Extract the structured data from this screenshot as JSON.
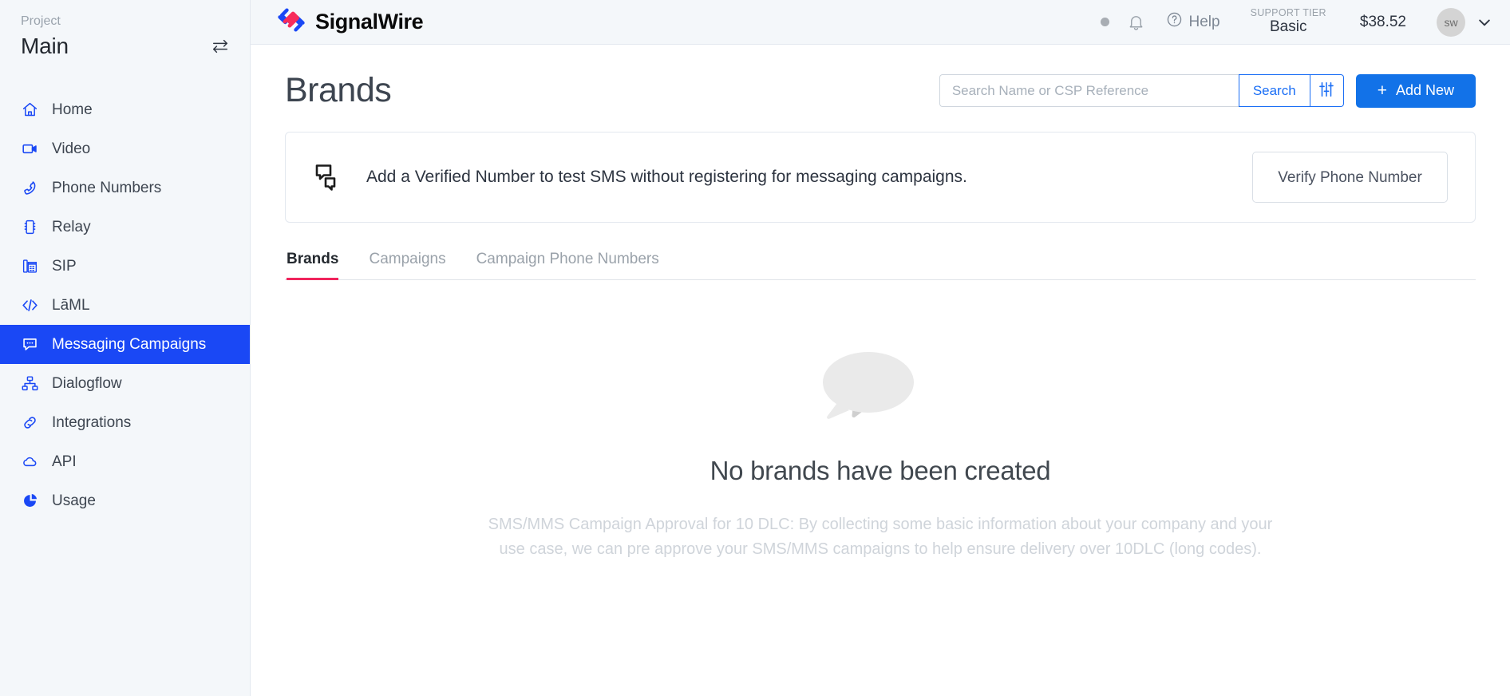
{
  "sidebar": {
    "project_label": "Project",
    "project_name": "Main",
    "swap_icon": "swap-arrows-icon",
    "items": [
      {
        "label": "Home",
        "icon": "home-icon",
        "active": false
      },
      {
        "label": "Video",
        "icon": "video-camera-icon",
        "active": false
      },
      {
        "label": "Phone Numbers",
        "icon": "phone-icon",
        "active": false
      },
      {
        "label": "Relay",
        "icon": "chip-icon",
        "active": false
      },
      {
        "label": "SIP",
        "icon": "desk-phone-icon",
        "active": false
      },
      {
        "label": "LāML",
        "icon": "code-brackets-icon",
        "active": false
      },
      {
        "label": "Messaging Campaigns",
        "icon": "chat-bubble-icon",
        "active": true
      },
      {
        "label": "Dialogflow",
        "icon": "sitemap-icon",
        "active": false
      },
      {
        "label": "Integrations",
        "icon": "link-icon",
        "active": false
      },
      {
        "label": "API",
        "icon": "cloud-icon",
        "active": false
      },
      {
        "label": "Usage",
        "icon": "pie-chart-icon",
        "active": false
      }
    ]
  },
  "topbar": {
    "brand_name": "SignalWire",
    "status_dot": "status-dot",
    "notifications_icon": "bell-icon",
    "help_icon": "question-circle-icon",
    "help_label": "Help",
    "support_tier_label": "SUPPORT TIER",
    "support_tier_value": "Basic",
    "balance": "$38.52",
    "avatar_initials": "sw",
    "caret_icon": "chevron-down-icon"
  },
  "page": {
    "title": "Brands"
  },
  "search": {
    "placeholder": "Search Name or CSP Reference",
    "value": "",
    "search_label": "Search",
    "filter_icon": "sliders-icon"
  },
  "add_new": {
    "label": "Add New",
    "plus": "+"
  },
  "banner": {
    "icon": "chat-bubbles-icon",
    "text": "Add a Verified Number to test SMS without registering for messaging campaigns.",
    "button_label": "Verify Phone Number"
  },
  "tabs": [
    {
      "label": "Brands",
      "active": true
    },
    {
      "label": "Campaigns",
      "active": false
    },
    {
      "label": "Campaign Phone Numbers",
      "active": false
    }
  ],
  "empty_state": {
    "illustration": "speech-bubbles-illustration",
    "title": "No brands have been created",
    "description": "SMS/MMS Campaign Approval for 10 DLC: By collecting some basic information about your company and your use case, we can pre approve your SMS/MMS campaigns to help ensure delivery over 10DLC (long codes)."
  },
  "colors": {
    "accent_blue": "#1a48f5",
    "button_blue": "#1272e8",
    "link_blue": "#1a6ef5",
    "tab_underline_pink": "#f0245c",
    "logo_pink": "#f72c5b",
    "sidebar_bg": "#f4f7fa"
  }
}
